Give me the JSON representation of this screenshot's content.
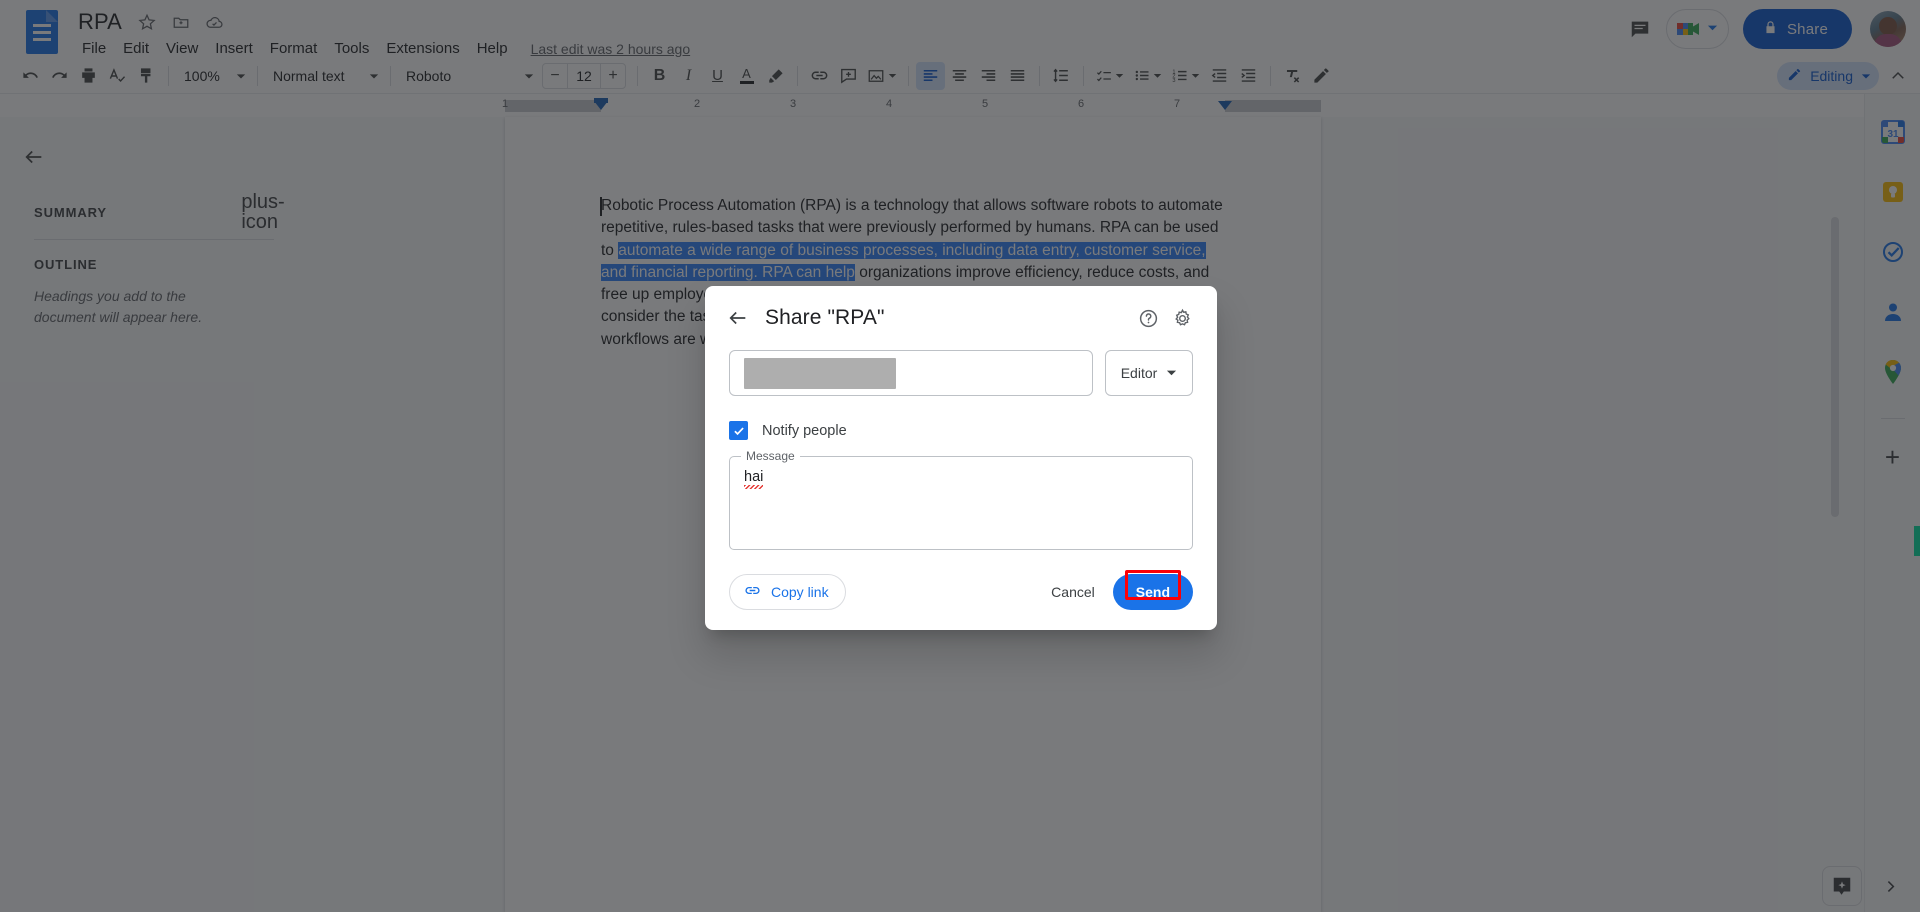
{
  "app": {
    "doc_title": "RPA",
    "last_edit": "Last edit was 2 hours ago",
    "logo_icon": "google-docs-icon"
  },
  "menubar": {
    "items": [
      {
        "label": "File"
      },
      {
        "label": "Edit"
      },
      {
        "label": "View"
      },
      {
        "label": "Insert"
      },
      {
        "label": "Format"
      },
      {
        "label": "Tools"
      },
      {
        "label": "Extensions"
      },
      {
        "label": "Help"
      }
    ]
  },
  "title_icons": [
    {
      "name": "star-icon"
    },
    {
      "name": "move-to-folder-icon"
    },
    {
      "name": "cloud-saved-icon"
    }
  ],
  "topbar_right": {
    "comment_icon": "comment-history-icon",
    "meet_icon": "google-meet-icon",
    "meet_caret": "chevron-down-icon",
    "share_label": "Share",
    "share_lock_icon": "lock-icon",
    "avatar": "user-avatar"
  },
  "toolbar": {
    "undo": "undo-icon",
    "redo": "redo-icon",
    "print": "print-icon",
    "spellcheck": "spellcheck-icon",
    "paint_format": "paint-format-icon",
    "zoom_value": "100%",
    "style_value": "Normal text",
    "font_value": "Roboto",
    "font_size_value": "12",
    "decrease_font": "−",
    "increase_font": "+",
    "bold": "B",
    "italic": "I",
    "underline": "U",
    "text_color": "A",
    "highlight": "highlighter-icon",
    "insert_link": "link-icon",
    "add_comment": "add-comment-icon",
    "insert_image": "insert-image-icon",
    "align_left": "align-left-icon",
    "align_center": "align-center-icon",
    "align_right": "align-right-icon",
    "align_justify": "align-justify-icon",
    "line_spacing": "line-spacing-icon",
    "checklist": "checklist-icon",
    "bulleted_list": "bulleted-list-icon",
    "numbered_list": "numbered-list-icon",
    "decrease_indent": "decrease-indent-icon",
    "increase_indent": "increase-indent-icon",
    "clear_formatting": "clear-formatting-icon",
    "pen": "editing-pen-icon",
    "mode_label": "Editing",
    "mode_icon": "pencil-icon",
    "mode_caret": "chevron-down-icon",
    "hide_menus": "chevron-up-icon"
  },
  "ruler": {
    "numbers": [
      "1",
      "2",
      "3",
      "4",
      "5",
      "6",
      "7"
    ]
  },
  "outline_panel": {
    "back_icon": "back-arrow-icon",
    "summary_label": "SUMMARY",
    "add_summary_icon": "plus-icon",
    "outline_label": "OUTLINE",
    "outline_hint": "Headings you add to the document will appear here."
  },
  "document": {
    "paragraph_parts": [
      {
        "text": "Robotic Process Automation (RPA) is a technology that allows software robots to automate repetitive, rules-based tasks that were previously performed by humans. RPA can be used to ",
        "selected": false
      },
      {
        "text": "automate a wide range of business processes, including data entry, customer service, and financial reporting. RPA can help",
        "selected": true
      },
      {
        "text": " organizations improve efficiency, reduce costs, and free up employees to focus on higher-value work. However, it is important to carefully consider the tasks that are most suitable for automation and to ensure that the automation workflows are well-designed and tested. RPA is a key enabler of digital transformation.",
        "selected": false
      }
    ]
  },
  "app_rail": {
    "items": [
      {
        "name": "google-calendar-icon"
      },
      {
        "name": "google-keep-icon"
      },
      {
        "name": "google-tasks-icon"
      },
      {
        "name": "google-contacts-icon"
      },
      {
        "name": "google-maps-icon"
      }
    ],
    "add_label": "+",
    "explore_icon": "explore-sparkle-icon",
    "expand_icon": "chevron-right-icon"
  },
  "share_dialog": {
    "back_icon": "back-arrow-icon",
    "title": "Share \"RPA\"",
    "help_icon": "help-icon",
    "settings_icon": "gear-icon",
    "email_value": "",
    "email_redacted": true,
    "role_value": "Editor",
    "role_caret": "chevron-down-icon",
    "notify_checked": true,
    "notify_label": "Notify people",
    "message_legend": "Message",
    "message_value": "hai",
    "copy_link_label": "Copy link",
    "copy_link_icon": "link-icon",
    "cancel_label": "Cancel",
    "send_label": "Send",
    "highlight_color": "#fb0007"
  },
  "colors": {
    "google_blue": "#1a73e8",
    "share_blue": "#0b57d0",
    "selection_blue": "#2d7ff9",
    "annotation_red": "#fb0007"
  }
}
